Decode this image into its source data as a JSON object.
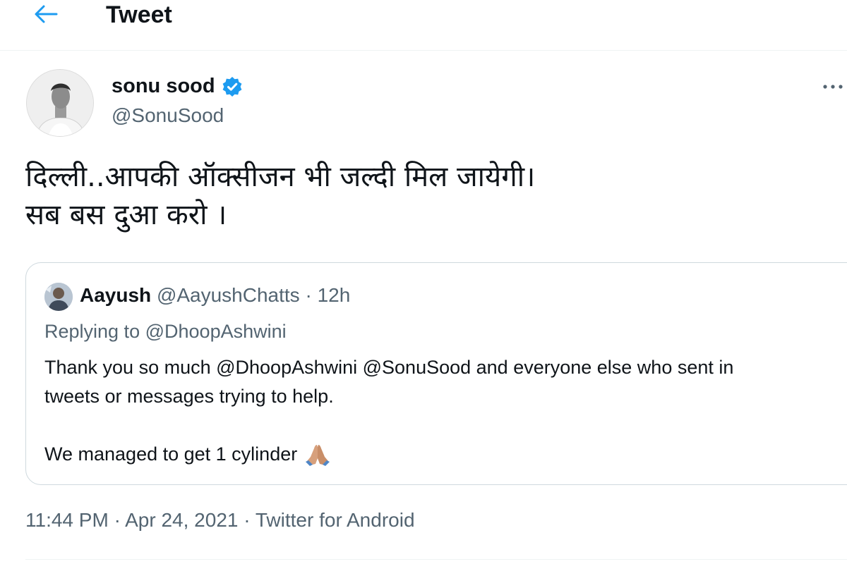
{
  "header": {
    "title": "Tweet",
    "back_icon": "arrow-left-icon",
    "accent_color": "#1d9bf0"
  },
  "author": {
    "name": "sonu sood",
    "handle": "@SonuSood",
    "verified_icon": "verified-badge-icon",
    "more_icon": "more-dots-icon"
  },
  "tweet": {
    "text": "दिल्ली..आपकी ऑक्सीजन भी जल्दी मिल जायेगी।\nसब बस दुआ करो ।"
  },
  "quoted_tweet": {
    "name": "Aayush",
    "handle": "@AayushChatts",
    "separator": "·",
    "time": "12h",
    "replying_prefix": "Replying to",
    "replying_to": "@DhoopAshwini",
    "body_line1": "Thank you so much @DhoopAshwini @SonuSood and everyone else who sent in",
    "body_line2": "tweets or messages trying to help.",
    "body_para2": "We managed to get 1 cylinder",
    "emoji": "folded-hands-emoji"
  },
  "meta": {
    "time": "11:44 PM",
    "separator1": "·",
    "date": "Apr 24, 2021",
    "separator2": "·",
    "source": "Twitter for Android"
  }
}
